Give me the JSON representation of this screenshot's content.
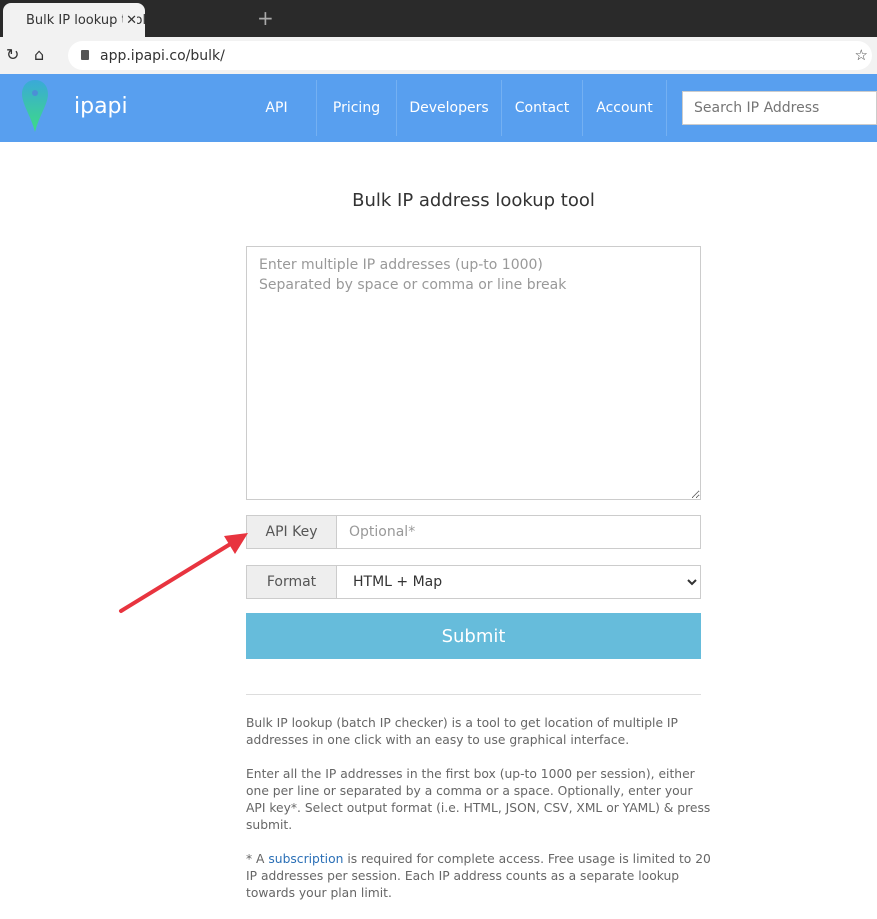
{
  "browser": {
    "tab_title": "Bulk IP lookup tool | Batch IP",
    "url": "app.ipapi.co/bulk/"
  },
  "nav": {
    "brand": "ipapi",
    "links": [
      "API",
      "Pricing",
      "Developers",
      "Contact",
      "Account"
    ],
    "search_placeholder": "Search IP Address"
  },
  "main": {
    "title": "Bulk IP address lookup tool",
    "textarea_placeholder": "Enter multiple IP addresses (up-to 1000)\nSeparated by space or comma or line break",
    "api_key_label": "API Key",
    "api_key_placeholder": "Optional*",
    "format_label": "Format",
    "format_value": "HTML + Map",
    "submit_label": "Submit",
    "para1": "Bulk IP lookup (batch IP checker) is a tool to get location of multiple IP addresses in one click with an easy to use graphical interface.",
    "para2": "Enter all the IP addresses in the first box (up-to 1000 per session), either one per line or separated by a comma or a space. Optionally, enter your API key*. Select output format (i.e. HTML, JSON, CSV, XML or YAML) & press submit.",
    "para3_prefix": "* A ",
    "para3_link": "subscription",
    "para3_suffix": " is required for complete access. Free usage is limited to 20 IP addresses per session. Each IP address counts as a separate lookup towards your plan limit."
  },
  "colors": {
    "nav": "#589fef",
    "submit": "#66bcdb",
    "annotation_arrow": "#e8343f"
  }
}
